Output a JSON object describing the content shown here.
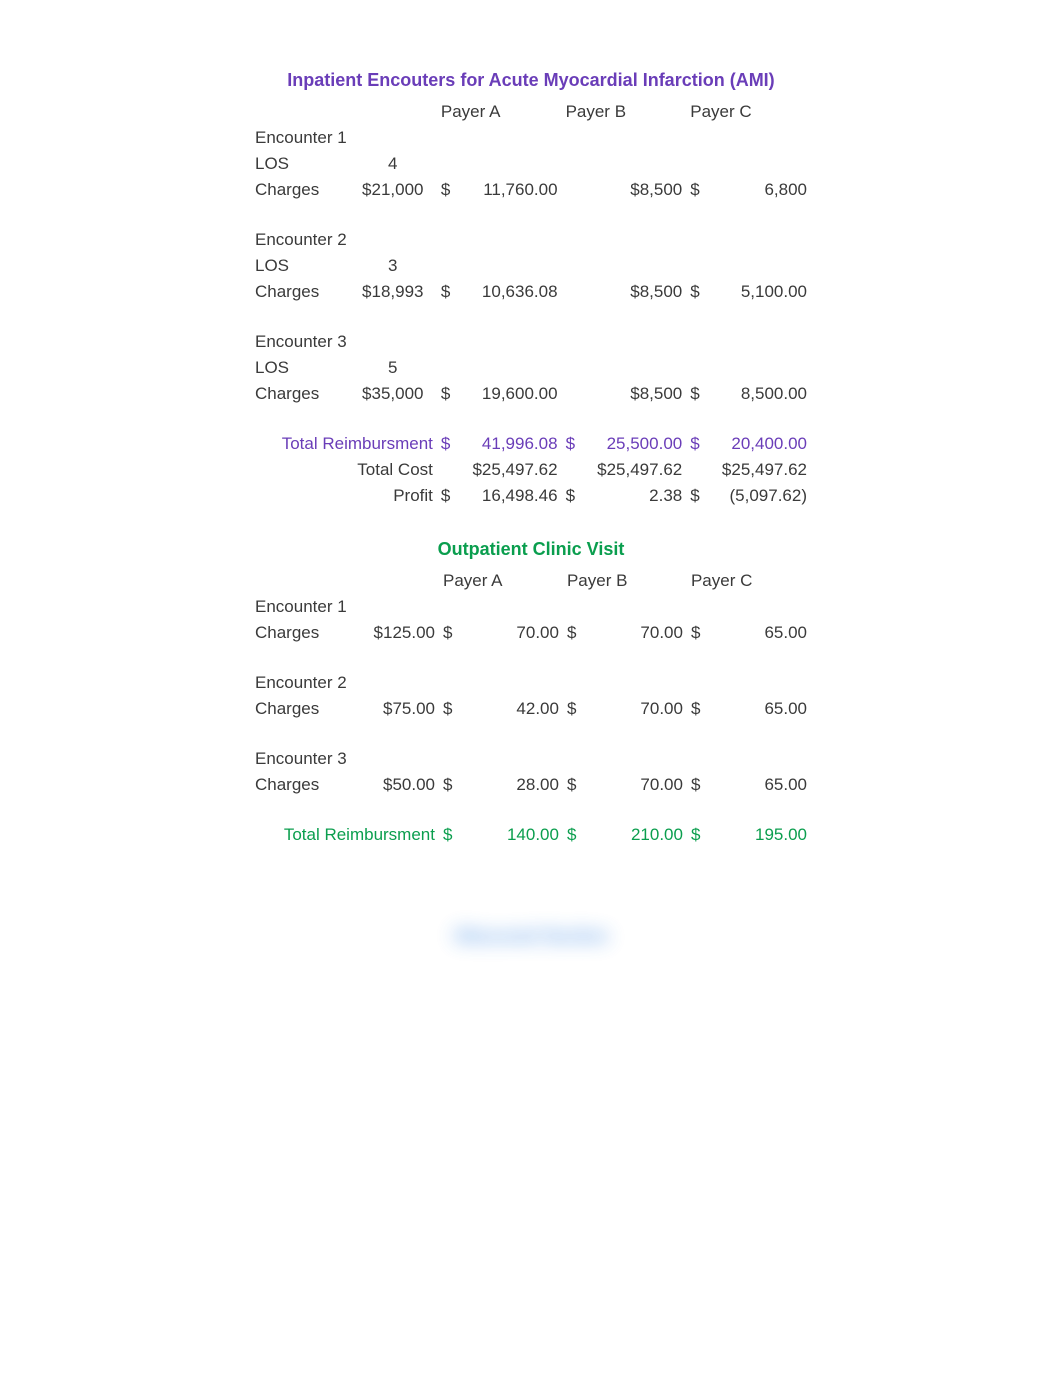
{
  "labels": {
    "payerA": "Payer A",
    "payerB": "Payer B",
    "payerC": "Payer C",
    "los": "LOS",
    "charges": "Charges",
    "enc1": "Encounter 1",
    "enc2": "Encounter 2",
    "enc3": "Encounter 3",
    "totalReimb": "Total Reimbursment",
    "totalCost": "Total Cost",
    "profit": "Profit",
    "dollar": "$"
  },
  "inpatient": {
    "title": "Inpatient Encouters for Acute Myocardial Infarction (AMI)",
    "encounters": [
      {
        "name": "Encounter 1",
        "los": "4",
        "charges": "$21,000",
        "payerA": "11,760.00",
        "payerB": "$8,500",
        "payerC": "6,800"
      },
      {
        "name": "Encounter 2",
        "los": "3",
        "charges": "$18,993",
        "payerA": "10,636.08",
        "payerB": "$8,500",
        "payerC": "5,100.00"
      },
      {
        "name": "Encounter 3",
        "los": "5",
        "charges": "$35,000",
        "payerA": "19,600.00",
        "payerB": "$8,500",
        "payerC": "8,500.00"
      }
    ],
    "summary": {
      "totalReimb": {
        "payerA": "41,996.08",
        "payerB": "25,500.00",
        "payerC": "20,400.00"
      },
      "totalCost": {
        "payerA": "$25,497.62",
        "payerB": "$25,497.62",
        "payerC": "$25,497.62"
      },
      "profit": {
        "payerA": "16,498.46",
        "payerB": "2.38",
        "payerC": "(5,097.62)"
      }
    }
  },
  "outpatient": {
    "title": "Outpatient Clinic Visit",
    "encounters": [
      {
        "name": "Encounter 1",
        "charges": "$125.00",
        "payerA": "70.00",
        "payerB": "70.00",
        "payerC": "65.00"
      },
      {
        "name": "Encounter 2",
        "charges": "$75.00",
        "payerA": "42.00",
        "payerB": "70.00",
        "payerC": "65.00"
      },
      {
        "name": "Encounter 3",
        "charges": "$50.00",
        "payerA": "28.00",
        "payerB": "70.00",
        "payerC": "65.00"
      }
    ],
    "summary": {
      "totalReimb": {
        "payerA": "140.00",
        "payerB": "210.00",
        "payerC": "195.00"
      }
    }
  },
  "blurred": {
    "title": "Obscured Section"
  }
}
